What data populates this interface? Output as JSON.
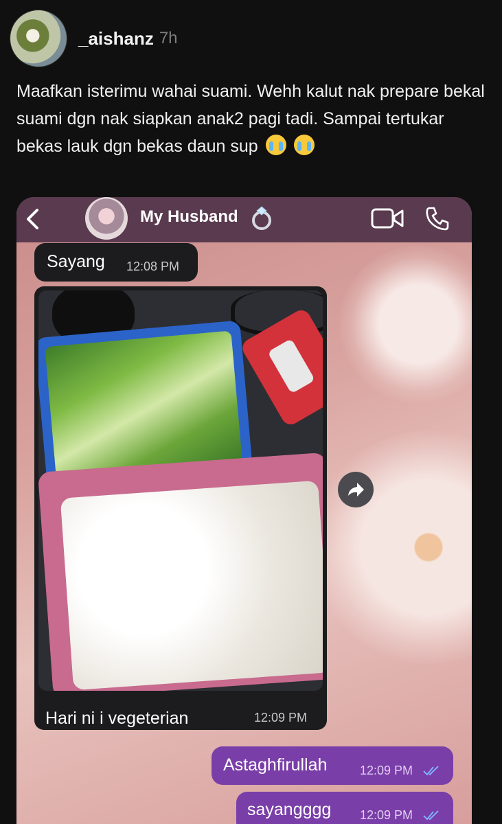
{
  "post": {
    "username": "_aishanz",
    "time": "7h",
    "caption": "Maafkan isterimu wahai suami. Wehh kalut nak prepare bekal suami dgn nak siapkan anak2 pagi tadi. Sampai tertukar bekas lauk dgn bekas daun sup"
  },
  "chat": {
    "contact_name": "My Husband",
    "messages": [
      {
        "text": "Sayang",
        "time": "12:08 PM"
      },
      {
        "text": "Hari ni i vegeterian",
        "time": "12:09 PM"
      },
      {
        "text": "Astaghfirullah",
        "time": "12:09 PM"
      },
      {
        "text": "sayangggg",
        "time": "12:09 PM"
      }
    ]
  },
  "colors": {
    "background": "#101010",
    "chat_header": "#5a3a4e",
    "incoming_bubble": "#1c1c1e",
    "outgoing_bubble": "#7a3ea8",
    "read_ticks": "#7fb0ff"
  },
  "icons": [
    "back-icon",
    "ring-emoji-icon",
    "video-call-icon",
    "phone-icon",
    "forward-icon",
    "read-check-icon",
    "crying-face-emoji"
  ]
}
